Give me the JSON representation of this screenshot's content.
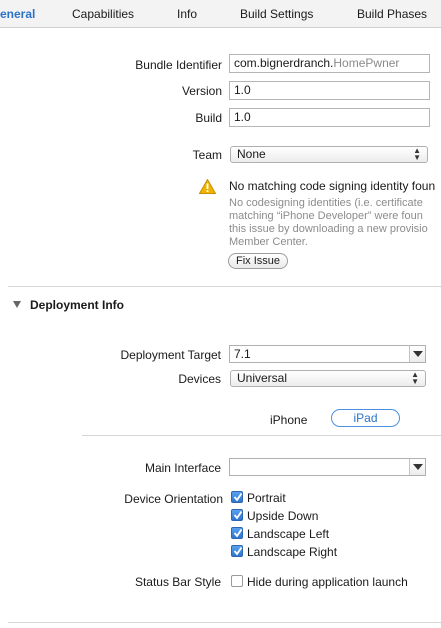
{
  "tabs": [
    {
      "label": "eneral",
      "active": true
    },
    {
      "label": "Capabilities",
      "active": false
    },
    {
      "label": "Info",
      "active": false
    },
    {
      "label": "Build Settings",
      "active": false
    },
    {
      "label": "Build Phases",
      "active": false
    }
  ],
  "identity": {
    "bundle_identifier_label": "Bundle Identifier",
    "bundle_identifier_prefix": "com.bignerdranch.",
    "bundle_identifier_suffix": "HomePwner",
    "version_label": "Version",
    "version_value": "1.0",
    "build_label": "Build",
    "build_value": "1.0",
    "team_label": "Team",
    "team_value": "None"
  },
  "signing_warning": {
    "title": "No matching code signing identity foun",
    "lines": [
      "No codesigning identities (i.e. certificate",
      "matching “iPhone Developer” were foun",
      "this issue by downloading a new provisio",
      "Member Center."
    ],
    "fix_button": "Fix Issue"
  },
  "deployment": {
    "section_title": "Deployment Info",
    "target_label": "Deployment Target",
    "target_value": "7.1",
    "devices_label": "Devices",
    "devices_value": "Universal",
    "device_tabs": [
      "iPhone",
      "iPad"
    ],
    "selected_device_tab": "iPad",
    "main_interface_label": "Main Interface",
    "main_interface_value": "",
    "orientation_label": "Device Orientation",
    "orientations": [
      {
        "label": "Portrait",
        "checked": true
      },
      {
        "label": "Upside Down",
        "checked": true
      },
      {
        "label": "Landscape Left",
        "checked": true
      },
      {
        "label": "Landscape Right",
        "checked": true
      }
    ],
    "status_bar_label": "Status Bar Style",
    "hide_status_bar_label": "Hide during application launch",
    "hide_status_bar_checked": false
  },
  "colors": {
    "accent": "#2a73c9",
    "warning": "#f0b400"
  }
}
